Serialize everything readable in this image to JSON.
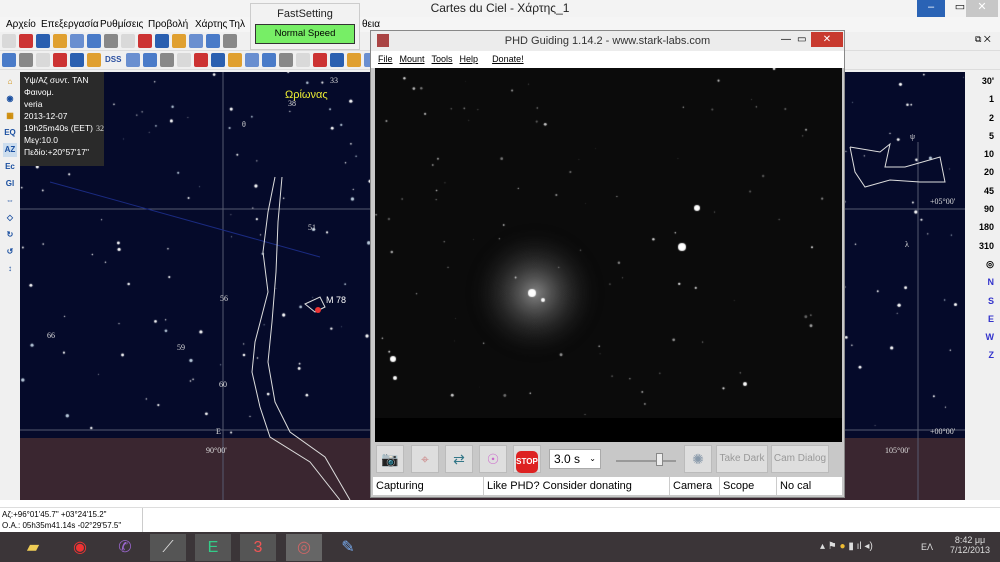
{
  "window": {
    "title": "Cartes du Ciel - Χάρτης_1"
  },
  "menu": [
    "Αρχείο",
    "Επεξεργασία",
    "Ρυθμίσεις",
    "Προβολή",
    "Χάρτης",
    "Τηλ",
    "θεια"
  ],
  "fast_setting": {
    "title": "FastSetting",
    "button": "Normal Speed"
  },
  "toolbar": {
    "dss_label": "DSS"
  },
  "left_toolbar": [
    "EQ",
    "AZ",
    "Ec",
    "Gl"
  ],
  "info": [
    "Υψ/Αζ συντ. TAN",
    "Φαινομ.",
    "veria",
    "2013-12-07",
    "19h25m40s (EET)",
    "Μεγ:10.0",
    "Πεδίο:+20°57'17\""
  ],
  "map_labels": {
    "constellation": "Ωρίωνας",
    "stars": [
      "33",
      "38",
      "51",
      "56",
      "59",
      "60",
      "66",
      "32"
    ],
    "object": "M 78",
    "greek": [
      "θ",
      "ψ",
      "λ"
    ],
    "east": "E",
    "grid": [
      "90°00'",
      "+05°00'",
      "+00°00'",
      "105°00'"
    ]
  },
  "scale": [
    "30'",
    "1",
    "2",
    "5",
    "10",
    "20",
    "45",
    "90",
    "180",
    "310"
  ],
  "directions": [
    "N",
    "S",
    "E",
    "W",
    "Z"
  ],
  "phd": {
    "title": "PHD Guiding 1.14.2  -  www.stark-labs.com",
    "menu": [
      "File",
      "Mount",
      "Tools",
      "Help",
      "Donate!"
    ],
    "exposure": "3.0 s",
    "stop": "STOP",
    "take_dark": "Take Dark",
    "cam_dialog": "Cam Dialog",
    "status": [
      "Capturing",
      "Like PHD? Consider donating",
      "Camera",
      "Scope",
      "No cal"
    ]
  },
  "status": {
    "azalt": "Αζ:+96°01'45.7\" +03°24'15.2\"",
    "radec": "O.A.: 05h35m41.14s -02°29'57.5\""
  },
  "tray": {
    "lang": "ΕΛ",
    "time": "8:42 μμ",
    "date": "7/12/2013"
  }
}
